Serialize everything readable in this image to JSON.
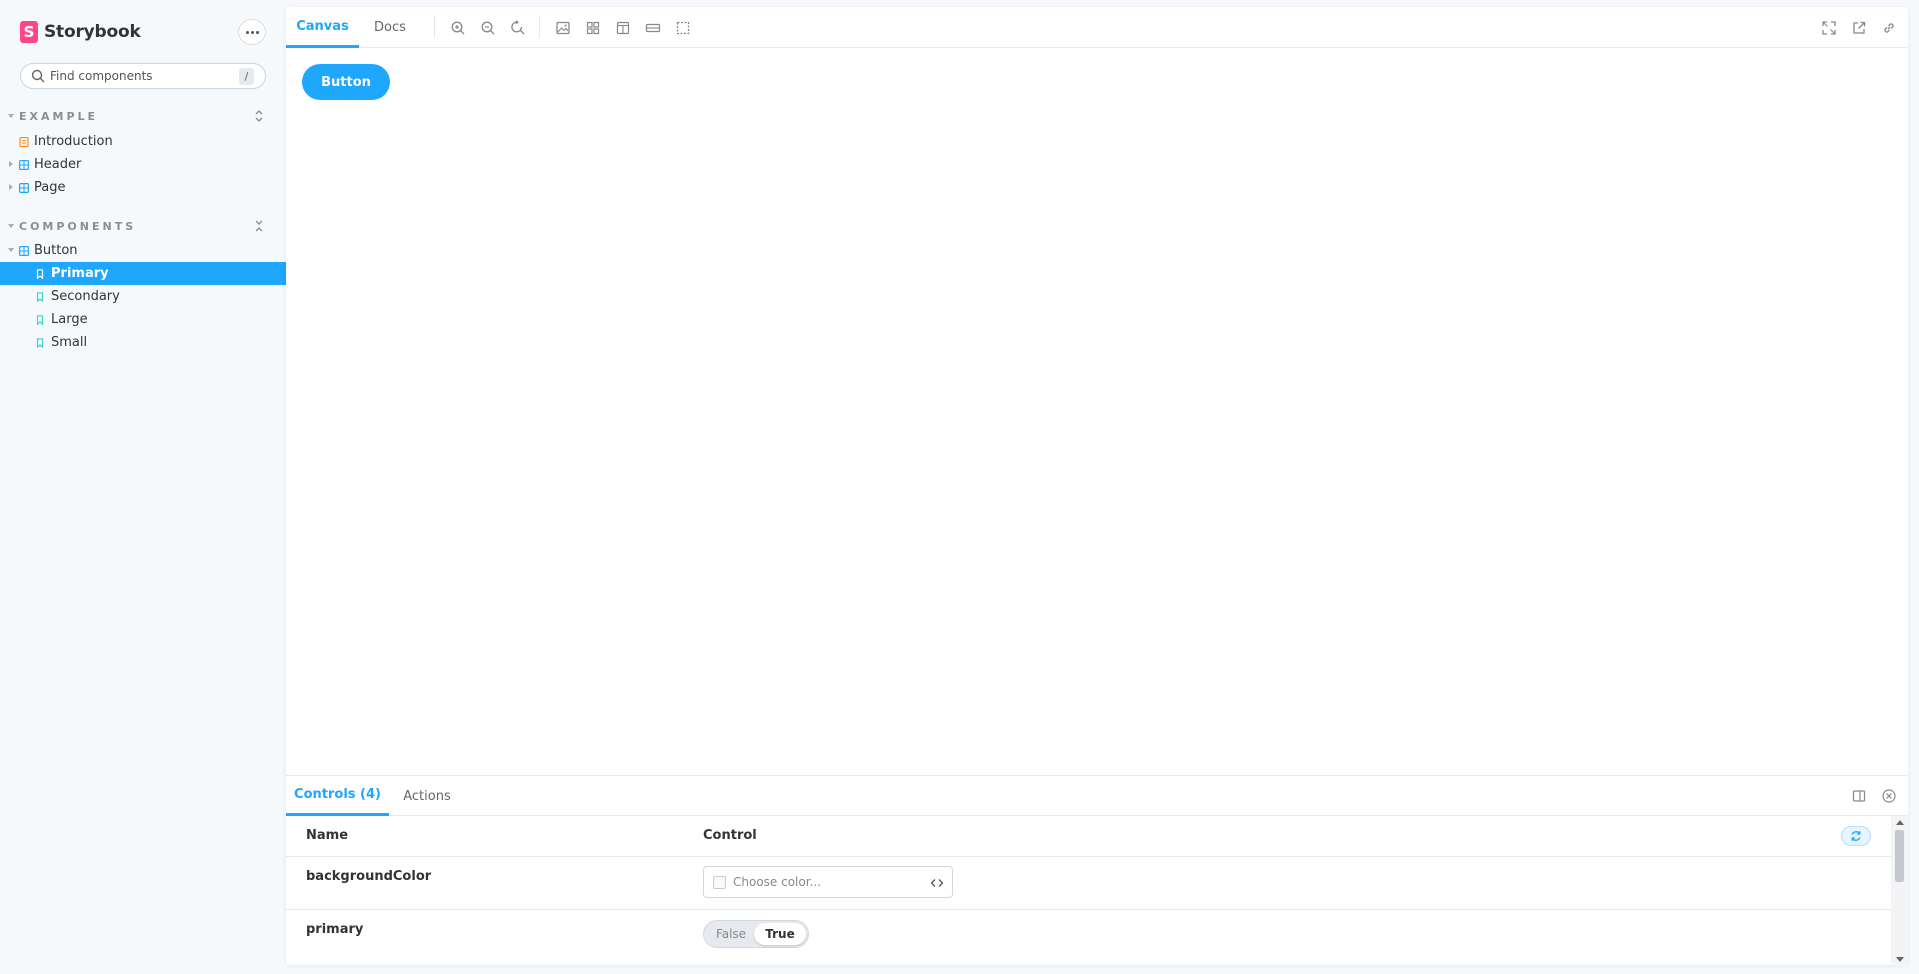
{
  "brand": {
    "name": "Storybook",
    "logo_letter": "S",
    "color": "#ff4785"
  },
  "search": {
    "placeholder": "Find components",
    "shortcut": "/"
  },
  "sidebar": {
    "groups": [
      {
        "title": "EXAMPLE",
        "items": [
          {
            "label": "Introduction",
            "icon": "document-icon"
          },
          {
            "label": "Header",
            "icon": "component-icon"
          },
          {
            "label": "Page",
            "icon": "component-icon"
          }
        ]
      },
      {
        "title": "COMPONENTS",
        "items": [
          {
            "label": "Button",
            "icon": "component-icon",
            "children": [
              {
                "label": "Primary",
                "icon": "bookmark-icon",
                "selected": true
              },
              {
                "label": "Secondary",
                "icon": "bookmark-icon"
              },
              {
                "label": "Large",
                "icon": "bookmark-icon"
              },
              {
                "label": "Small",
                "icon": "bookmark-icon"
              }
            ]
          }
        ]
      }
    ]
  },
  "toolbar": {
    "tabs": [
      "Canvas",
      "Docs"
    ],
    "active_tab": "Canvas",
    "tools": [
      "zoom-in-icon",
      "zoom-out-icon",
      "zoom-reset-icon",
      "background-icon",
      "grid-icon",
      "viewport-icon",
      "measure-icon",
      "outline-icon"
    ],
    "right_tools": [
      "fullscreen-icon",
      "open-new-tab-icon",
      "copy-link-icon"
    ]
  },
  "canvas": {
    "button_label": "Button"
  },
  "addons": {
    "tabs": [
      "Controls (4)",
      "Actions"
    ],
    "active_tab": "Controls (4)",
    "table": {
      "headers": {
        "name": "Name",
        "control": "Control"
      },
      "rows": [
        {
          "name": "backgroundColor",
          "control": "color",
          "placeholder": "Choose color..."
        },
        {
          "name": "primary",
          "control": "boolean",
          "false_label": "False",
          "true_label": "True",
          "value": true
        }
      ]
    }
  },
  "colors": {
    "accent": "#1ea7fd",
    "sidebar_bg": "#f6f9fc",
    "text": "#333333"
  }
}
